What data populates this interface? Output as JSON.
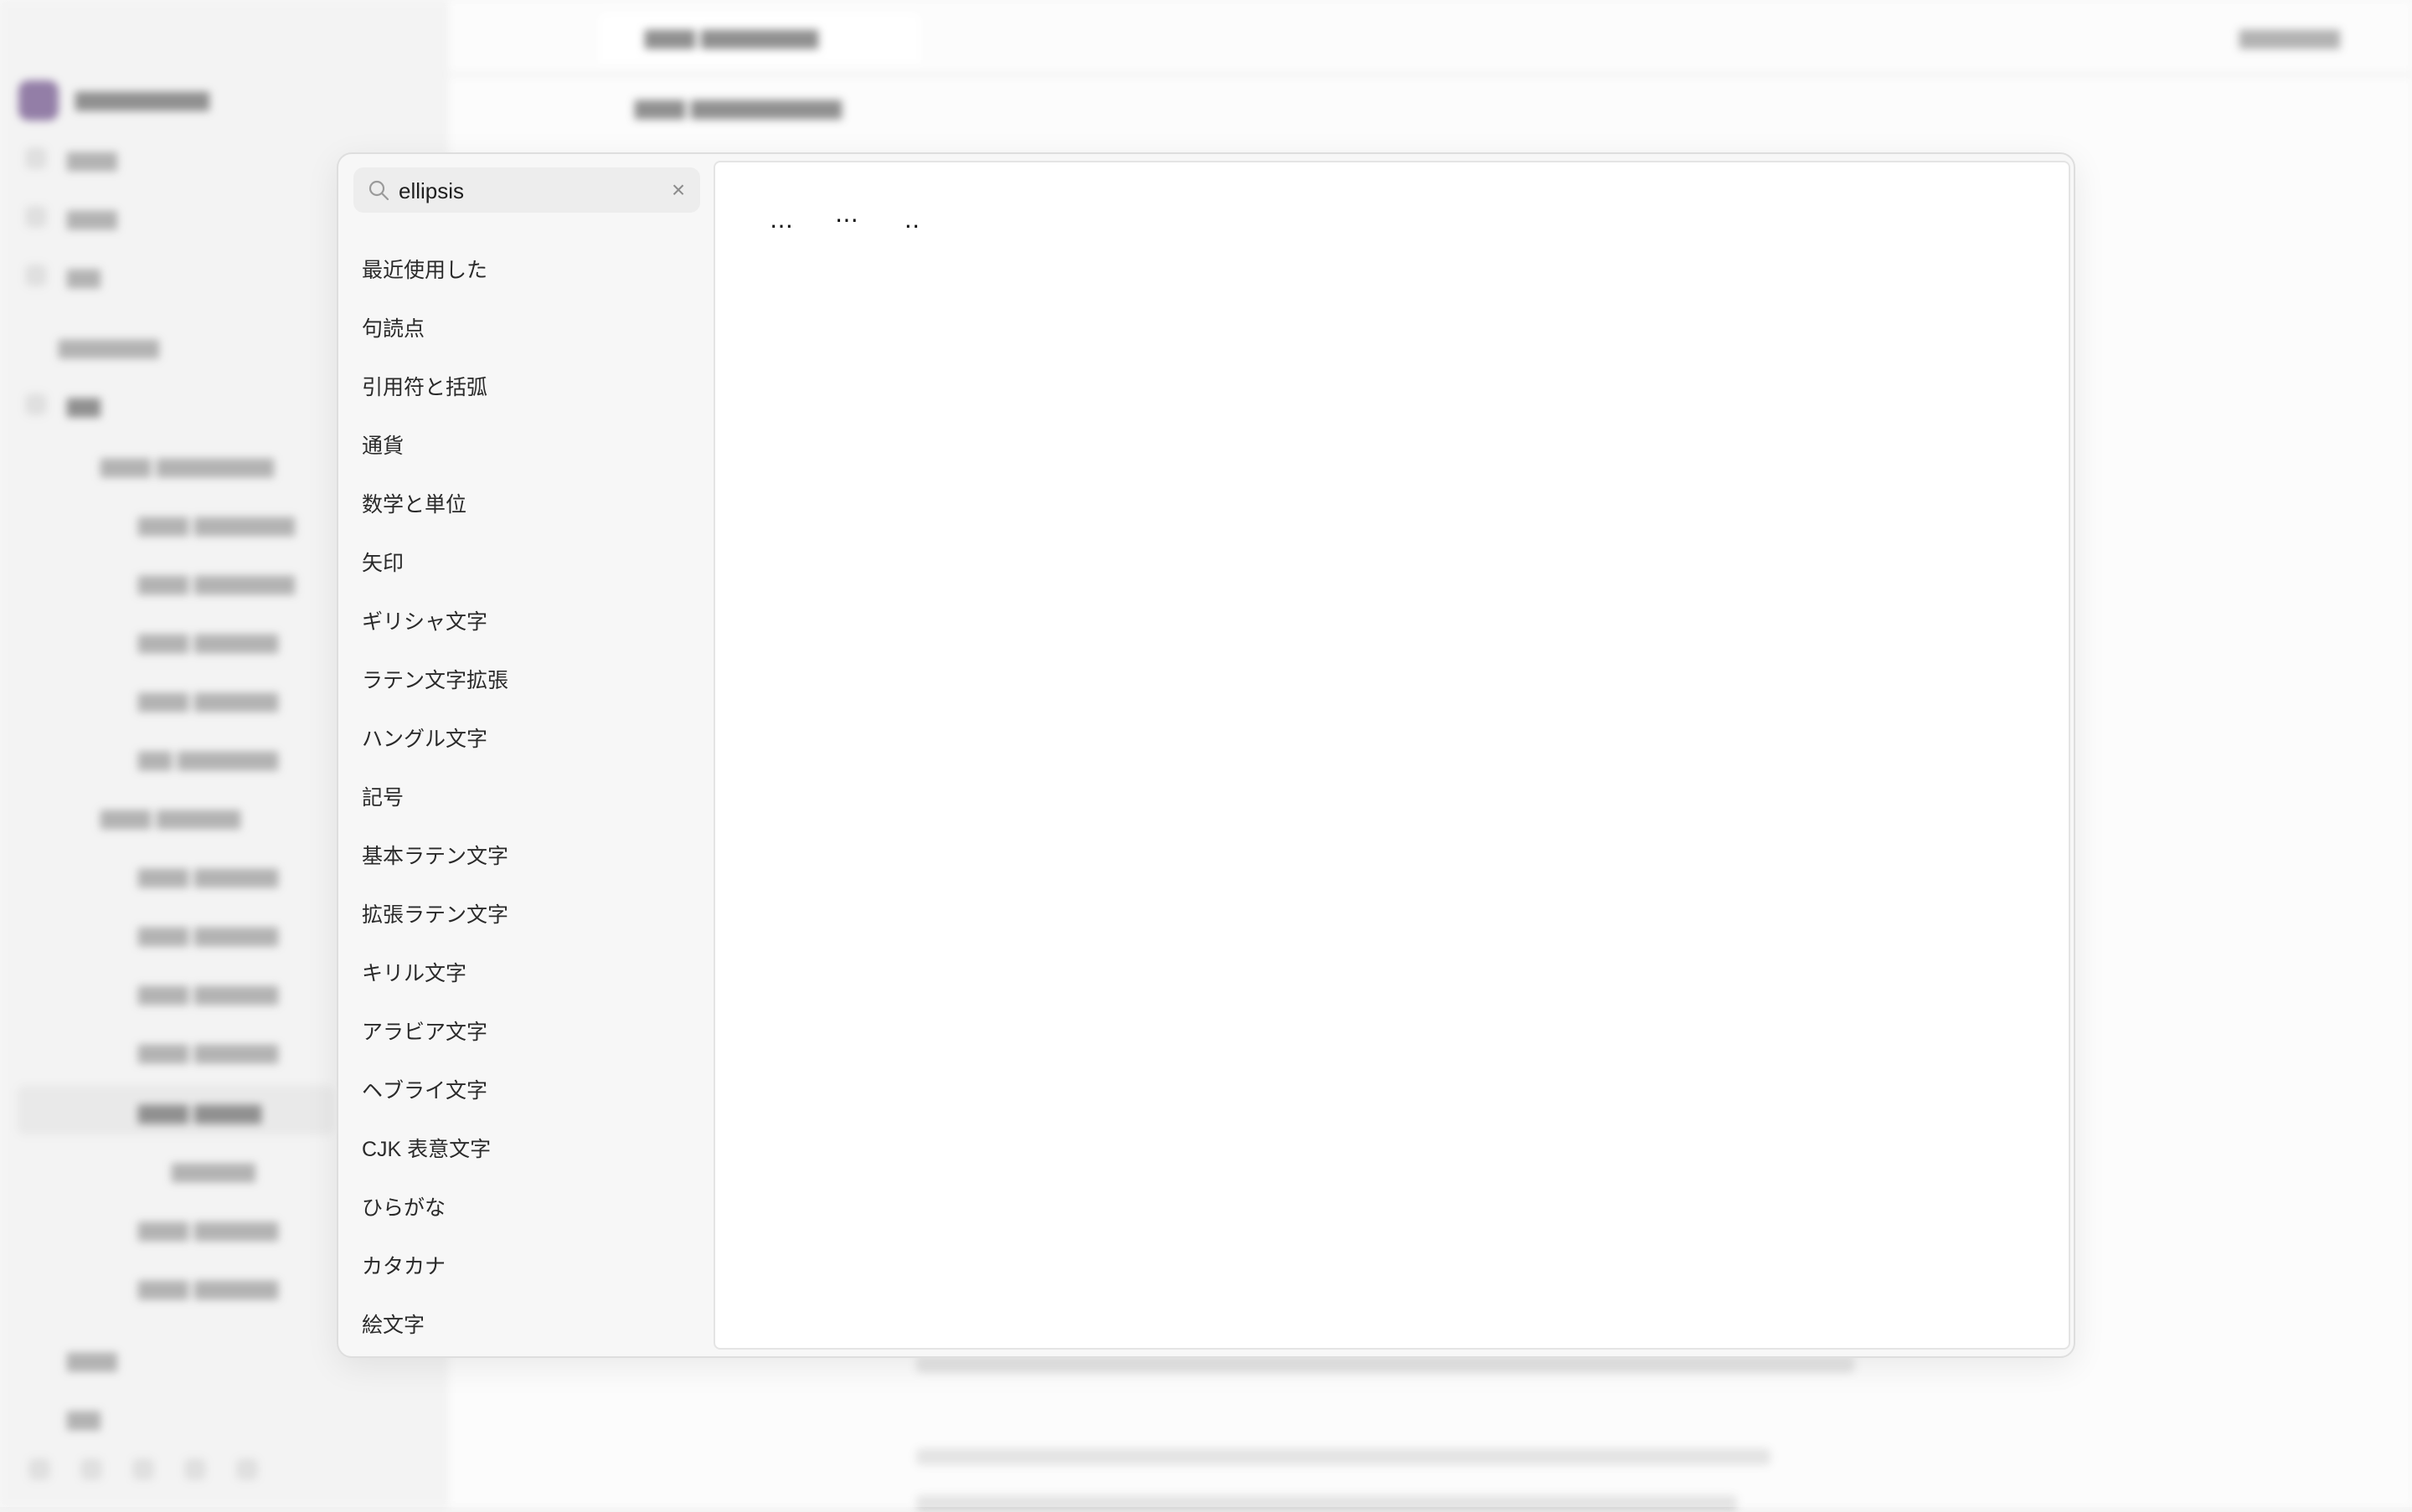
{
  "search": {
    "value": "ellipsis",
    "clear_icon": "×"
  },
  "categories": [
    {
      "label": "最近使用した"
    },
    {
      "label": "句読点"
    },
    {
      "label": "引用符と括弧"
    },
    {
      "label": "通貨"
    },
    {
      "label": "数学と単位"
    },
    {
      "label": "矢印"
    },
    {
      "label": "ギリシャ文字"
    },
    {
      "label": "ラテン文字拡張"
    },
    {
      "label": "ハングル文字"
    },
    {
      "label": "記号"
    },
    {
      "label": "基本ラテン文字"
    },
    {
      "label": "拡張ラテン文字"
    },
    {
      "label": "キリル文字"
    },
    {
      "label": "アラビア文字"
    },
    {
      "label": "ヘブライ文字"
    },
    {
      "label": "CJK 表意文字"
    },
    {
      "label": "ひらがな"
    },
    {
      "label": "カタカナ"
    },
    {
      "label": "絵文字"
    }
  ],
  "results": [
    {
      "char": "…"
    },
    {
      "char": "⋯"
    },
    {
      "char": "‥"
    }
  ],
  "icons": {
    "search": "search-icon",
    "clear": "close-icon"
  },
  "colors": {
    "picker_bg": "#f7f7f7",
    "result_bg": "#ffffff",
    "search_bg": "#ededed",
    "text": "#2a2a2a"
  }
}
